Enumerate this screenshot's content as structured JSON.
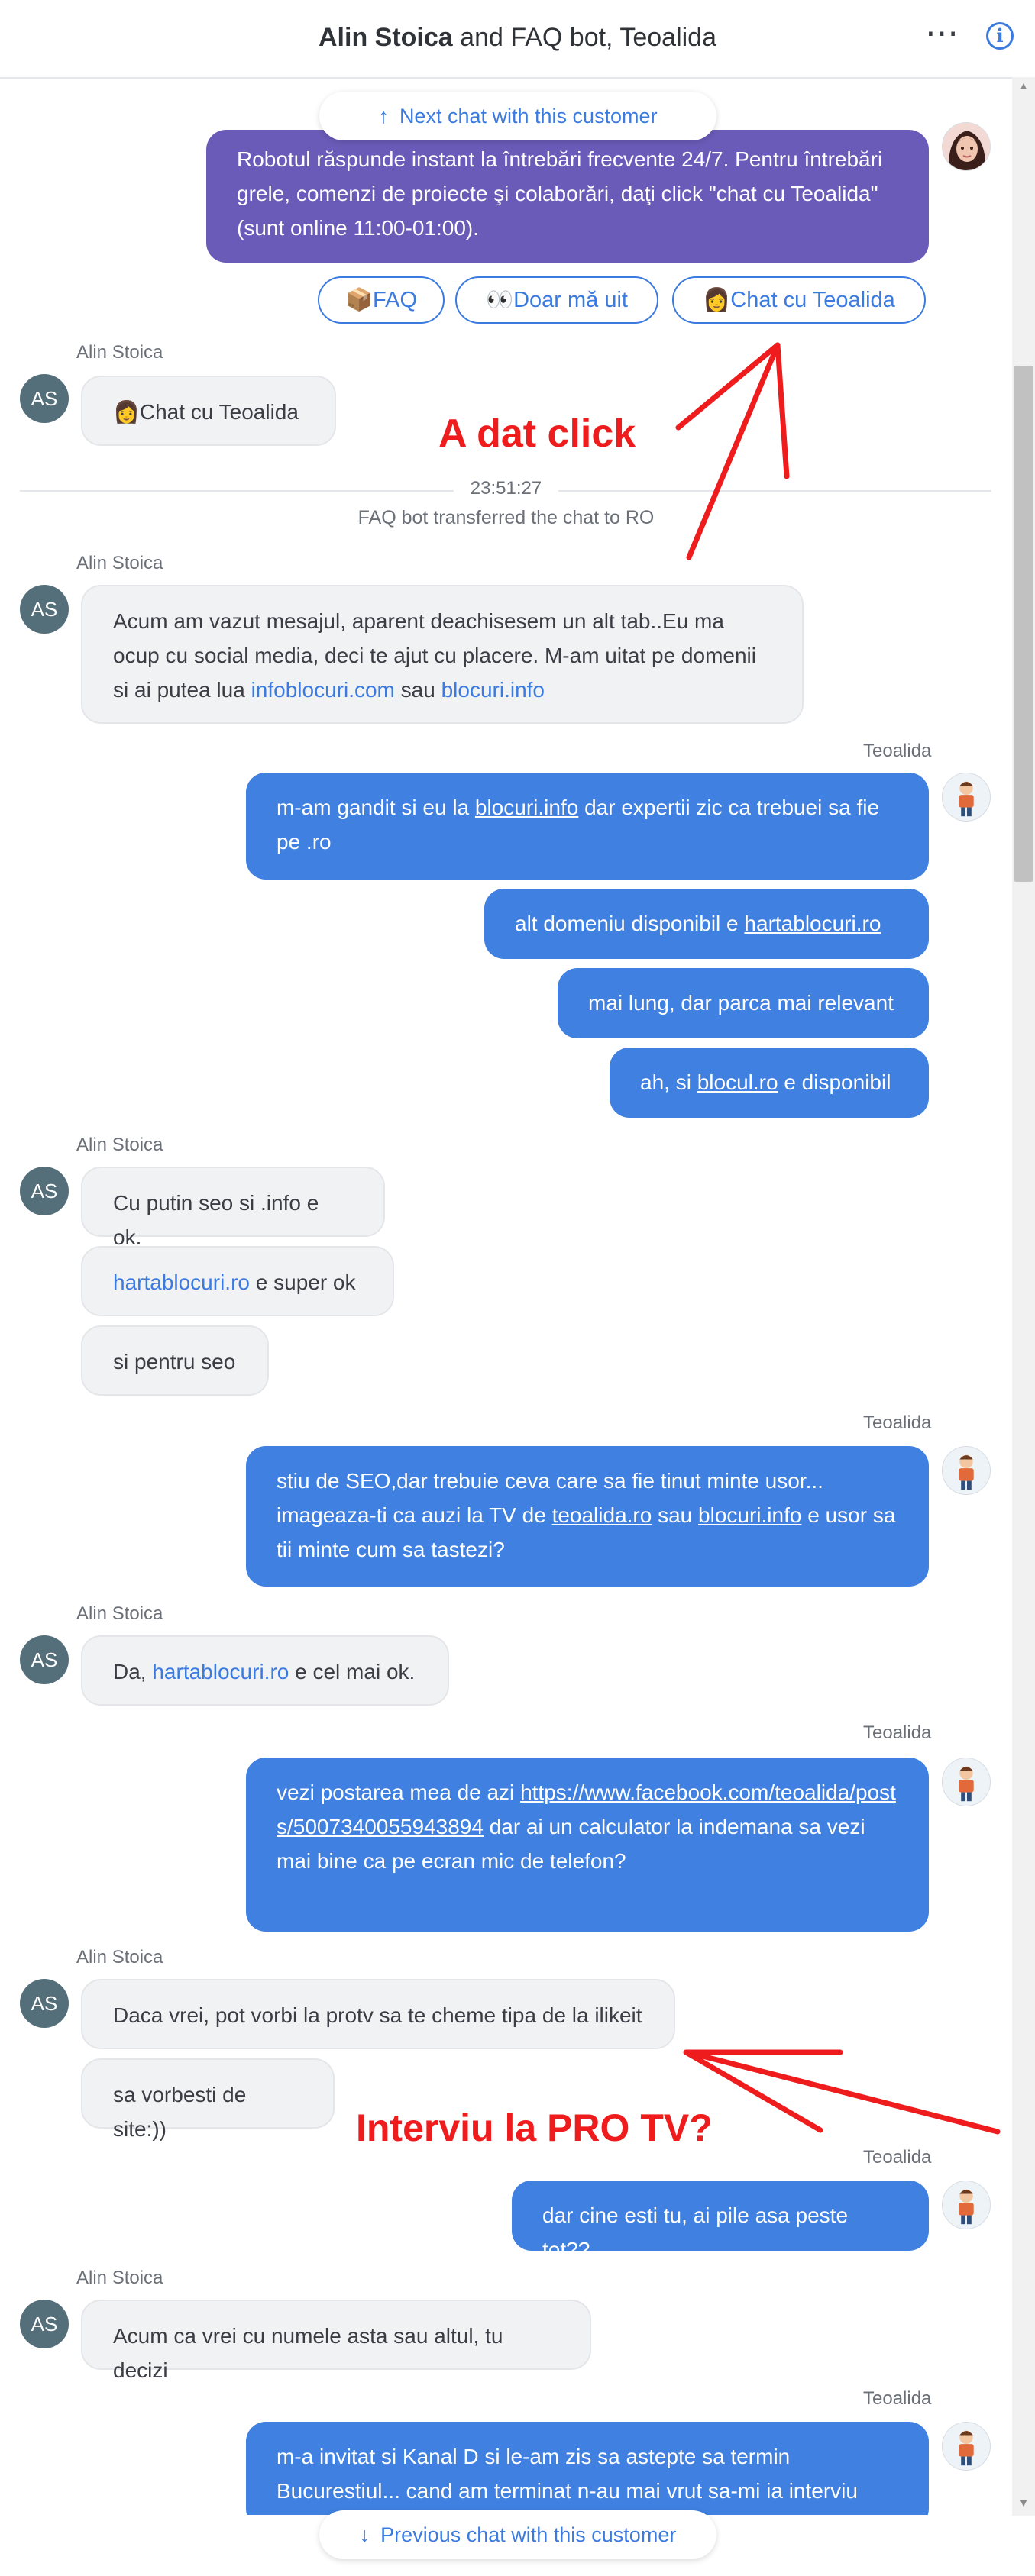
{
  "header": {
    "participant_primary": "Alin Stoica",
    "participant_rest": "and FAQ bot, Teoalida",
    "more_icon": "⋯",
    "info_icon": "i"
  },
  "nav": {
    "next_chat": "Next chat with this customer",
    "previous_chat": "Previous chat with this customer",
    "up_arrow": "↑",
    "down_arrow": "↓"
  },
  "bot_message": "Robotul răspunde instant la întrebări frecvente 24/7. Pentru întrebări grele, comenzi de proiecte şi colaborări, daţi click \"chat cu Teoalida\" (sunt online 11:00-01:00).",
  "quick_replies": [
    "📦FAQ",
    "👀Doar mă uit",
    "👩Chat cu Teoalida"
  ],
  "names": {
    "customer": "Alin Stoica",
    "agent": "Teoalida",
    "customer_initials": "AS"
  },
  "customer_pick": "👩Chat cu Teoalida",
  "divider": {
    "time": "23:51:27",
    "note": "FAQ bot transferred the chat to RO"
  },
  "messages": {
    "m1": {
      "pre": "Acum am vazut mesajul, aparent deachisesem un alt tab..Eu ma ocup cu social media, deci te ajut cu placere. M-am uitat pe domenii si ai putea lua ",
      "link1": "infoblocuri.com",
      "mid": " sau ",
      "link2": "blocuri.info"
    },
    "m2": {
      "pre": "m-am gandit si eu la ",
      "link": "blocuri.info",
      "post": " dar expertii zic ca trebuei sa fie pe .ro"
    },
    "m3": {
      "pre": "alt domeniu disponibil e ",
      "link": "hartablocuri.ro"
    },
    "m4": "mai lung, dar parca mai relevant",
    "m5": {
      "pre": "ah, si ",
      "link": "blocul.ro",
      "post": " e disponibil"
    },
    "m6": "Cu putin seo si .info e ok.",
    "m7": {
      "link": "hartablocuri.ro",
      "post": " e super ok"
    },
    "m8": "si pentru seo",
    "m9": {
      "pre": "stiu de SEO,dar trebuie ceva care sa fie tinut minte usor... imageaza-ti ca auzi la TV de ",
      "link1": "teoalida.ro",
      "mid": " sau ",
      "link2": "blocuri.info",
      "post": " e usor sa tii minte cum sa tastezi?"
    },
    "m10": {
      "pre": "Da, ",
      "link": "hartablocuri.ro",
      "post": " e cel mai ok."
    },
    "m11": {
      "pre": "vezi postarea mea de azi ",
      "link": "https://www.facebook.com/teoalida/posts/5007340055943894",
      "post": " dar ai un calculator la indemana sa vezi mai bine ca pe ecran mic de telefon?"
    },
    "m12": "Daca vrei, pot vorbi la protv sa te cheme tipa de la ilikeit",
    "m13": "sa vorbesti de site:))",
    "m14": "dar cine esti tu, ai pile asa peste tot??",
    "m15": "Acum ca vrei cu numele asta sau altul, tu decizi",
    "m16": "m-a invitat si Kanal D si le-am zis sa astepte sa termin Bucurestiul... cand am terminat n-au mai vrut sa-mi ia interviu"
  },
  "annotations": {
    "a1": "A dat click",
    "a2": "Interviu la PRO TV?"
  },
  "colors": {
    "agent_bubble": "#3f80e0",
    "bot_bubble": "#6a5bb8",
    "customer_bubble": "#f1f2f4",
    "accent": "#3b7be0",
    "annotation": "#ee1c1c"
  }
}
